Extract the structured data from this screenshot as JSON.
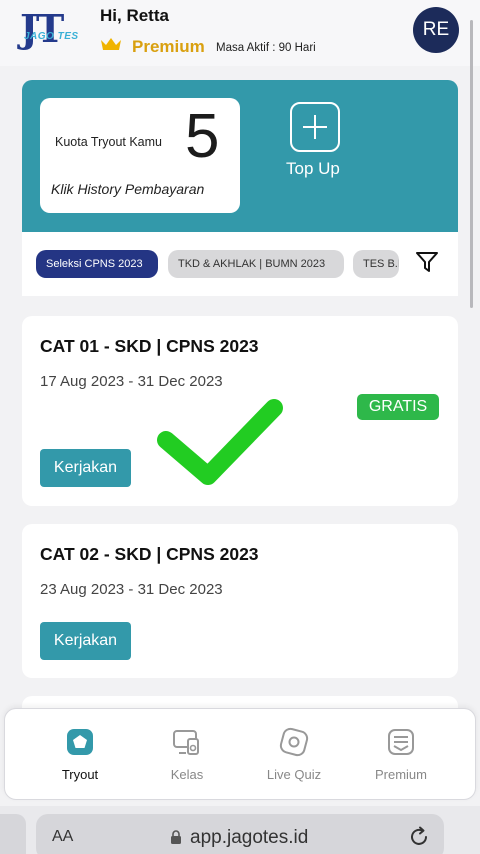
{
  "header": {
    "logo_text": "JT",
    "logo_sub": "JAGO TES",
    "greeting": "Hi, Retta",
    "membership": "Premium",
    "membership_note": "Masa Aktif : 90 Hari",
    "avatar_initials": "RE"
  },
  "quota": {
    "label": "Kuota Tryout Kamu",
    "count": "5",
    "history_link": "Klik History Pembayaran",
    "topup_label": "Top Up"
  },
  "filters": {
    "chips": [
      "Seleksi CPNS 2023",
      "TKD & AKHLAK | BUMN 2023",
      "TES B.I"
    ]
  },
  "tryouts": [
    {
      "title": "CAT 01 - SKD | CPNS 2023",
      "dates": "17 Aug 2023 - 31 Dec 2023",
      "badge": "GRATIS",
      "action": "Kerjakan"
    },
    {
      "title": "CAT 02 - SKD | CPNS 2023",
      "dates": "23 Aug 2023 - 31 Dec 2023",
      "action": "Kerjakan"
    }
  ],
  "nav": {
    "items": [
      "Tryout",
      "Kelas",
      "Live Quiz",
      "Premium"
    ]
  },
  "browser": {
    "aa": "AA",
    "url": "app.jagotes.id"
  },
  "colors": {
    "accent": "#3399aa",
    "navy": "#243584",
    "premium_gold": "#d9a010",
    "gratis_green": "#2eb84a",
    "check_green": "#22cc22"
  }
}
